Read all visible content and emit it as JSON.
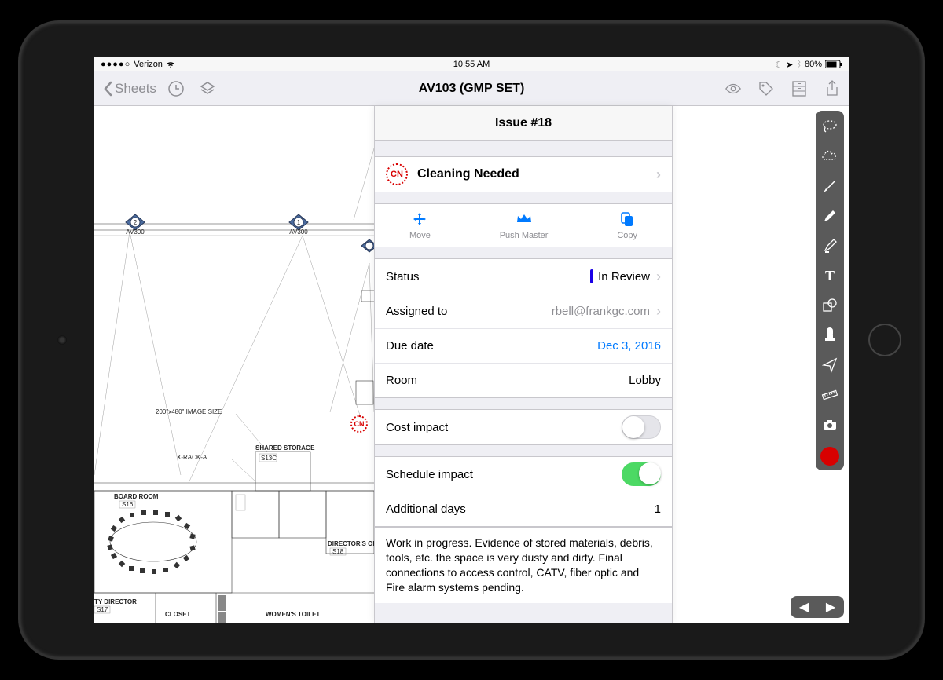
{
  "statusbar": {
    "carrier": "Verizon",
    "time": "10:55 AM",
    "battery_pct": "80%"
  },
  "navbar": {
    "back_label": "Sheets",
    "title": "AV103 (GMP SET)"
  },
  "panel": {
    "title": "Issue #18",
    "type_code": "CN",
    "type_label": "Cleaning Needed",
    "actions": {
      "move": "Move",
      "push": "Push Master",
      "copy": "Copy"
    },
    "fields": {
      "status_label": "Status",
      "status_value": "In Review",
      "assigned_label": "Assigned to",
      "assigned_value": "rbell@frankgc.com",
      "due_label": "Due date",
      "due_value": "Dec 3, 2016",
      "room_label": "Room",
      "room_value": "Lobby",
      "cost_label": "Cost impact",
      "schedule_label": "Schedule impact",
      "additional_label": "Additional days",
      "additional_value": "1"
    },
    "description": "Work in progress. Evidence of stored materials, debris, tools, etc. the space is very dusty and dirty. Final connections to access control, CATV, fiber optic and Fire alarm systems pending."
  },
  "blueprint": {
    "image_size_label": "200\"x480\"  IMAGE SIZE",
    "xrack_label": "X-RACK-A",
    "shared_storage": "SHARED STORAGE",
    "shared_storage_code": "S13C",
    "board_room": "BOARD ROOM",
    "board_room_code": "S16",
    "director_office": "DIRECTOR'S OFFICE",
    "director_office_code": "S18",
    "deputy_director": "TY DIRECTOR",
    "deputy_director_code": "S17",
    "closet": "CLOSET",
    "womens_toilet": "WOMEN'S TOILET",
    "section_ref": "AV300",
    "cn_marker": "CN",
    "detail_1": "1",
    "detail_2": "2"
  }
}
